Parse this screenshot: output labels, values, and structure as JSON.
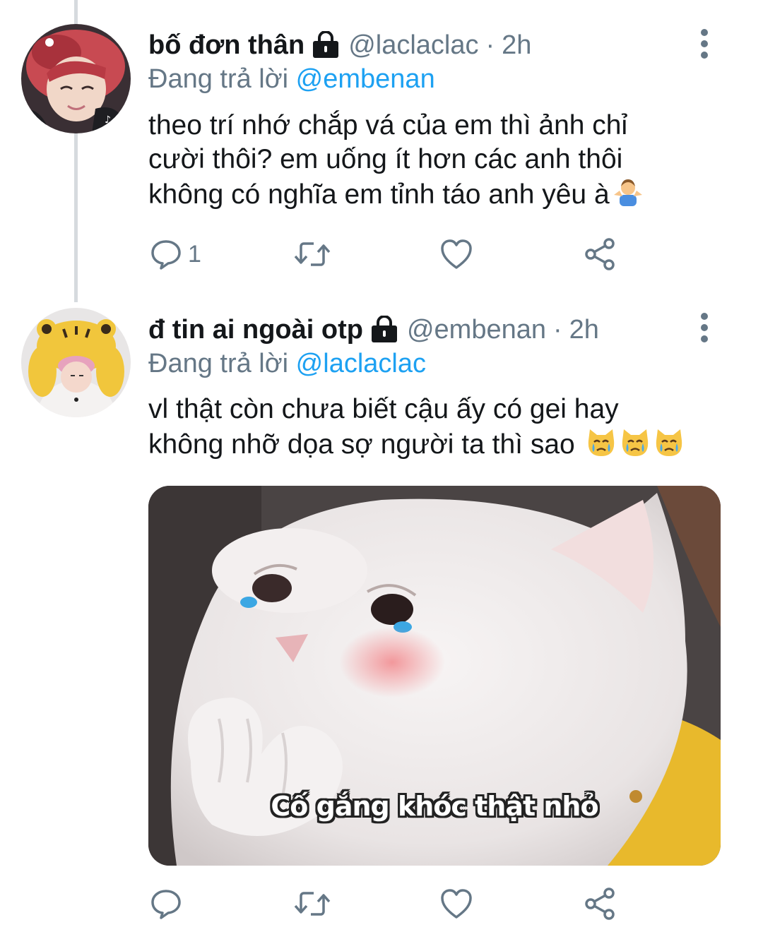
{
  "tweets": [
    {
      "display_name": "bố đơn thân",
      "handle": "@laclaclac",
      "separator": "·",
      "time": "2h",
      "replying_prefix": "Đang trả lời",
      "replying_to": "@embenan",
      "text_lines": [
        "theo trí nhớ chắp vá của em thì ảnh chỉ",
        "cười thôi? em uống ít hơn các anh thôi",
        "không có nghĩa em tỉnh táo anh yêu à"
      ],
      "text_emoji": "person-shrugging",
      "reply_count": "1",
      "avatar": "avatar-photo-red-hair"
    },
    {
      "display_name": "đ tin ai ngoài otp",
      "handle": "@embenan",
      "separator": "·",
      "time": "2h",
      "replying_prefix": "Đang trả lời",
      "replying_to": "@laclaclac",
      "text_lines": [
        "vl thật còn chưa biết cậu ấy có gei hay",
        "không nhỡ dọa sợ người ta thì sao"
      ],
      "text_emoji": "crying-cat-face x3",
      "media_caption": "Cố gắng khóc thật nhỏ",
      "media": "crying-white-cat-meme",
      "avatar": "avatar-photo-tiger-hat"
    }
  ],
  "icons": {
    "lock": "lock-icon",
    "more": "more-vertical-icon",
    "reply": "reply-icon",
    "retweet": "retweet-icon",
    "like": "like-icon",
    "share": "share-icon"
  },
  "colors": {
    "text": "#14171a",
    "secondary": "#657786",
    "link": "#1da1f2",
    "thread_line": "#d6dade"
  }
}
